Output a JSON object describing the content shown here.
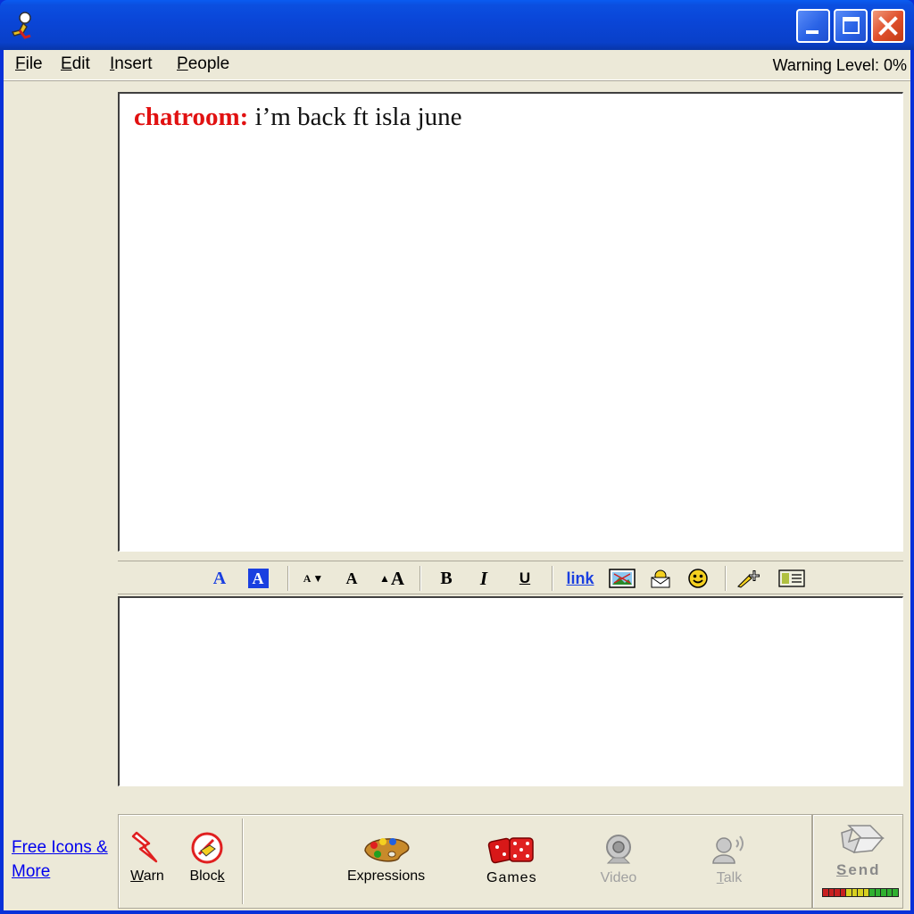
{
  "window": {
    "icons": {
      "app": "aim-running-man-icon",
      "minimize": "minimize-icon",
      "maximize": "maximize-icon",
      "close": "close-icon"
    }
  },
  "menu": {
    "items": [
      {
        "label_first": "F",
        "label_rest": "ile"
      },
      {
        "label_first": "E",
        "label_rest": "dit"
      },
      {
        "label_first": "I",
        "label_rest": "nsert"
      },
      {
        "label_first": "P",
        "label_rest": "eople"
      }
    ],
    "warning": "Warning Level: 0%"
  },
  "chat": {
    "messages": [
      {
        "sender": "chatroom:",
        "text": "i’m back ft isla june"
      }
    ],
    "sender_color": "#e11111"
  },
  "format_toolbar": {
    "link_label": "link",
    "bold_label": "B",
    "italic_label": "I",
    "underline_label": "U",
    "text_color_label": "A",
    "bg_color_label": "A",
    "font_smaller_label": "A",
    "font_normal_label": "A",
    "font_larger_label": "A"
  },
  "compose": {
    "value": ""
  },
  "sidebar": {
    "link_line1": "Free Icons &",
    "link_line2": "More"
  },
  "actions": {
    "warn": {
      "first": "W",
      "rest": "arn"
    },
    "block": {
      "rest": "Bloc",
      "last": "k"
    },
    "expressions": "Expressions",
    "games": "Games",
    "video": "Video",
    "talk": {
      "first": "T",
      "rest": "alk"
    }
  },
  "send": {
    "first": "S",
    "rest": "end"
  },
  "colors": {
    "accent_blue": "#0a46d8",
    "link_blue": "#0000ee"
  }
}
